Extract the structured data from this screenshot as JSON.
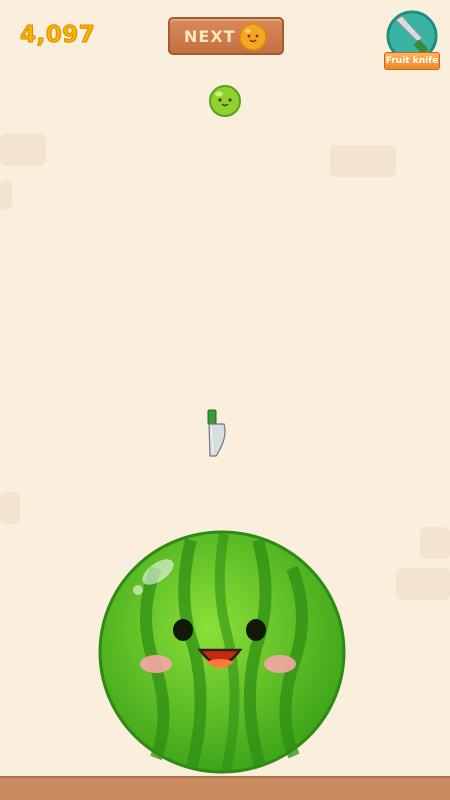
{
  "hud": {
    "score": "4,097",
    "next_label": "NEXT",
    "next_fruit_icon": "orange-icon",
    "powerup_label": "Fruit knife",
    "powerup_icon": "knife-icon"
  },
  "board": {
    "falling_fruit": "green-grape",
    "cursor_tool": "fruit-knife",
    "fruits": [
      "watermelon"
    ]
  },
  "colors": {
    "background": "#faefdc",
    "score": "#f5b400",
    "sign_wood": "#c97a4d",
    "floor": "#c98a5f",
    "watermelon": "#4cb01a"
  }
}
